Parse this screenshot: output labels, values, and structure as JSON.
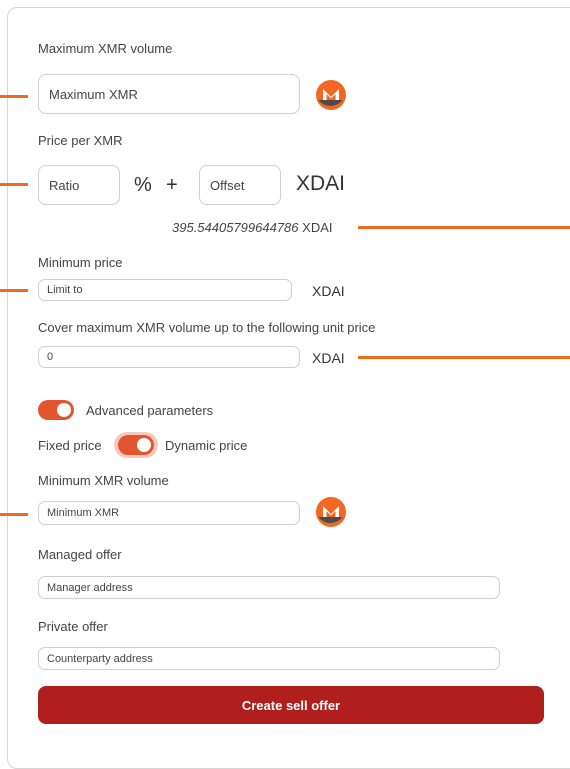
{
  "max_volume": {
    "label": "Maximum XMR volume",
    "placeholder": "Maximum XMR"
  },
  "price": {
    "label": "Price per XMR",
    "ratio_placeholder": "Ratio",
    "percent": "%",
    "plus": "+",
    "offset_placeholder": "Offset",
    "currency": "XDAI",
    "computed_value": "395.54405799644786",
    "computed_currency": "XDAI"
  },
  "min_price": {
    "label": "Minimum price",
    "placeholder": "Limit to",
    "currency": "XDAI"
  },
  "cover": {
    "label": "Cover maximum XMR volume up to the following unit price",
    "value": "0",
    "currency": "XDAI"
  },
  "advanced": {
    "label": "Advanced parameters",
    "enabled": true
  },
  "pricing_mode": {
    "left": "Fixed price",
    "right": "Dynamic price",
    "dynamic_selected": true
  },
  "min_volume": {
    "label": "Minimum XMR volume",
    "placeholder": "Minimum XMR"
  },
  "managed": {
    "label": "Managed offer",
    "placeholder": "Manager address"
  },
  "private": {
    "label": "Private offer",
    "placeholder": "Counterparty address"
  },
  "submit": {
    "label": "Create sell offer"
  },
  "colors": {
    "accent": "#ee6c1c",
    "toggle": "#e2562f",
    "button": "#b01e1e",
    "monero_orange": "#f26822",
    "monero_gray": "#4c4c4c"
  },
  "icons": {
    "currency_icon": "monero-icon"
  }
}
